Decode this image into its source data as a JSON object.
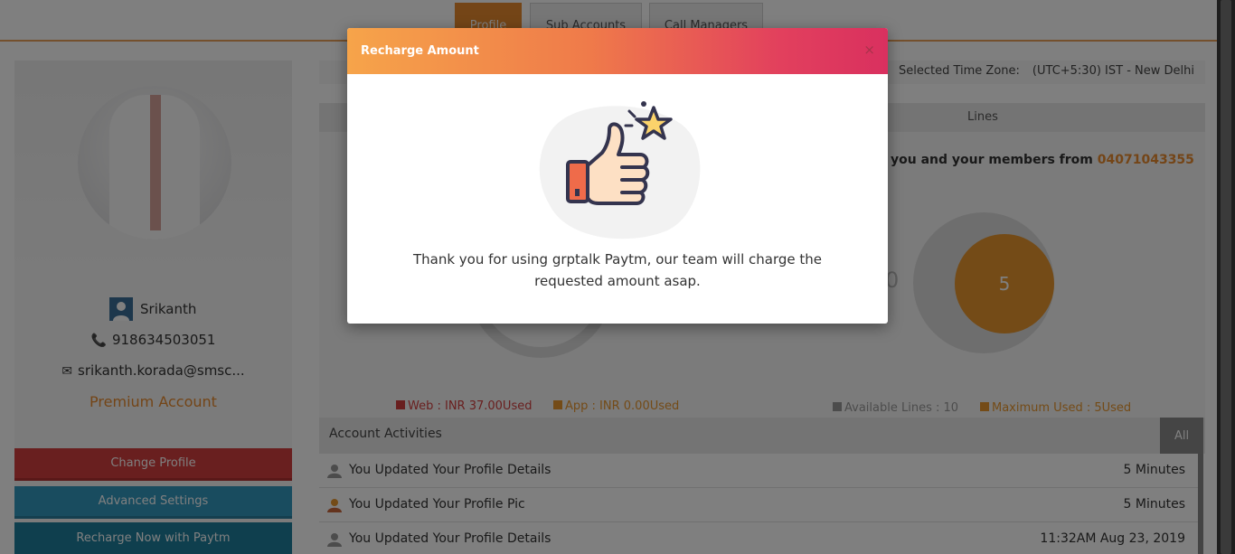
{
  "tabs": [
    {
      "label": "Profile",
      "active": true
    },
    {
      "label": "Sub Accounts",
      "active": false
    },
    {
      "label": "Call Managers",
      "active": false
    }
  ],
  "profile": {
    "name": "Srikanth",
    "phone": "918634503051",
    "email": "srikanth.korada@smsc...",
    "account_type": "Premium Account"
  },
  "buttons": {
    "change_profile": "Change Profile",
    "advanced_settings": "Advanced Settings",
    "recharge": "Recharge Now with Paytm"
  },
  "timezone": {
    "label": "Selected Time Zone:",
    "value": "(UTC+5:30) IST - New Delhi"
  },
  "lines_section": {
    "header": "Lines",
    "members_text": "you and your members from",
    "members_number": "04071043355",
    "center_zero": "0",
    "max_used_value": "5"
  },
  "legends": {
    "web": "Web : INR 37.00Used",
    "app": "App : INR 0.00Used",
    "available": "Available Lines : 10",
    "maximum": "Maximum Used : 5Used"
  },
  "colors": {
    "accent": "#e88a2e",
    "web": "#d33f3f",
    "app": "#e8962e",
    "available": "#999999"
  },
  "activities": {
    "title": "Account Activities",
    "all_label": "All",
    "rows": [
      {
        "icon": "user-gray-icon",
        "text": "You Updated Your Profile Details",
        "time": "5 Minutes"
      },
      {
        "icon": "user-orange-icon",
        "text": "You Updated Your Profile Pic",
        "time": "5 Minutes"
      },
      {
        "icon": "user-gray-icon",
        "text": "You Updated Your Profile Details",
        "time": "11:32AM Aug 23, 2019"
      }
    ]
  },
  "modal": {
    "title": "Recharge Amount",
    "close": "×",
    "illustration": "thumbs-up-star-icon",
    "message": "Thank you for using grptalk Paytm, our team will charge the requested amount asap."
  }
}
